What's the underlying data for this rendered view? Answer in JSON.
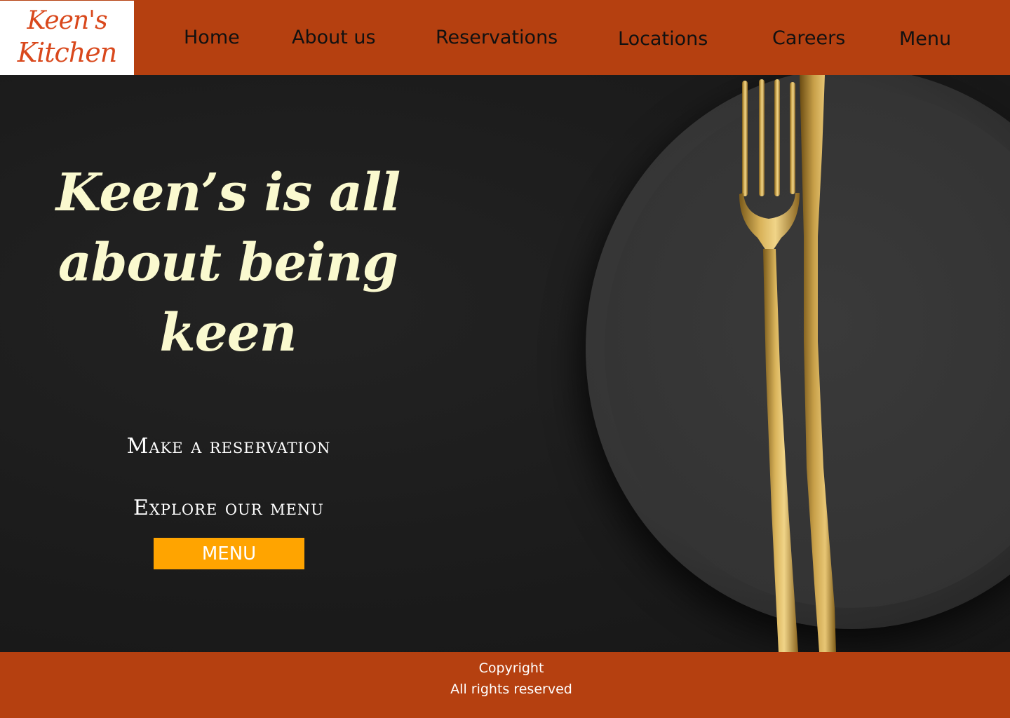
{
  "header": {
    "logo": {
      "line1": "Keen's",
      "line2": "Kitchen"
    },
    "nav": [
      {
        "label": "Home"
      },
      {
        "label": "About us"
      },
      {
        "label": "Reservations"
      },
      {
        "label": "Locations"
      },
      {
        "label": "Careers"
      },
      {
        "label": "Menu"
      }
    ]
  },
  "hero": {
    "headline_lines": [
      "Keen’s is all",
      "about being",
      "keen"
    ],
    "reservation_link": "Make a reservation",
    "explore_text": "Explore our menu",
    "menu_button": "MENU"
  },
  "footer": {
    "copyright": "Copyright",
    "rights": "All rights reserved"
  },
  "colors": {
    "brand": "#b54010",
    "accent": "#ffa400",
    "headline": "#faf9cf",
    "logo_text": "#d9481c"
  }
}
